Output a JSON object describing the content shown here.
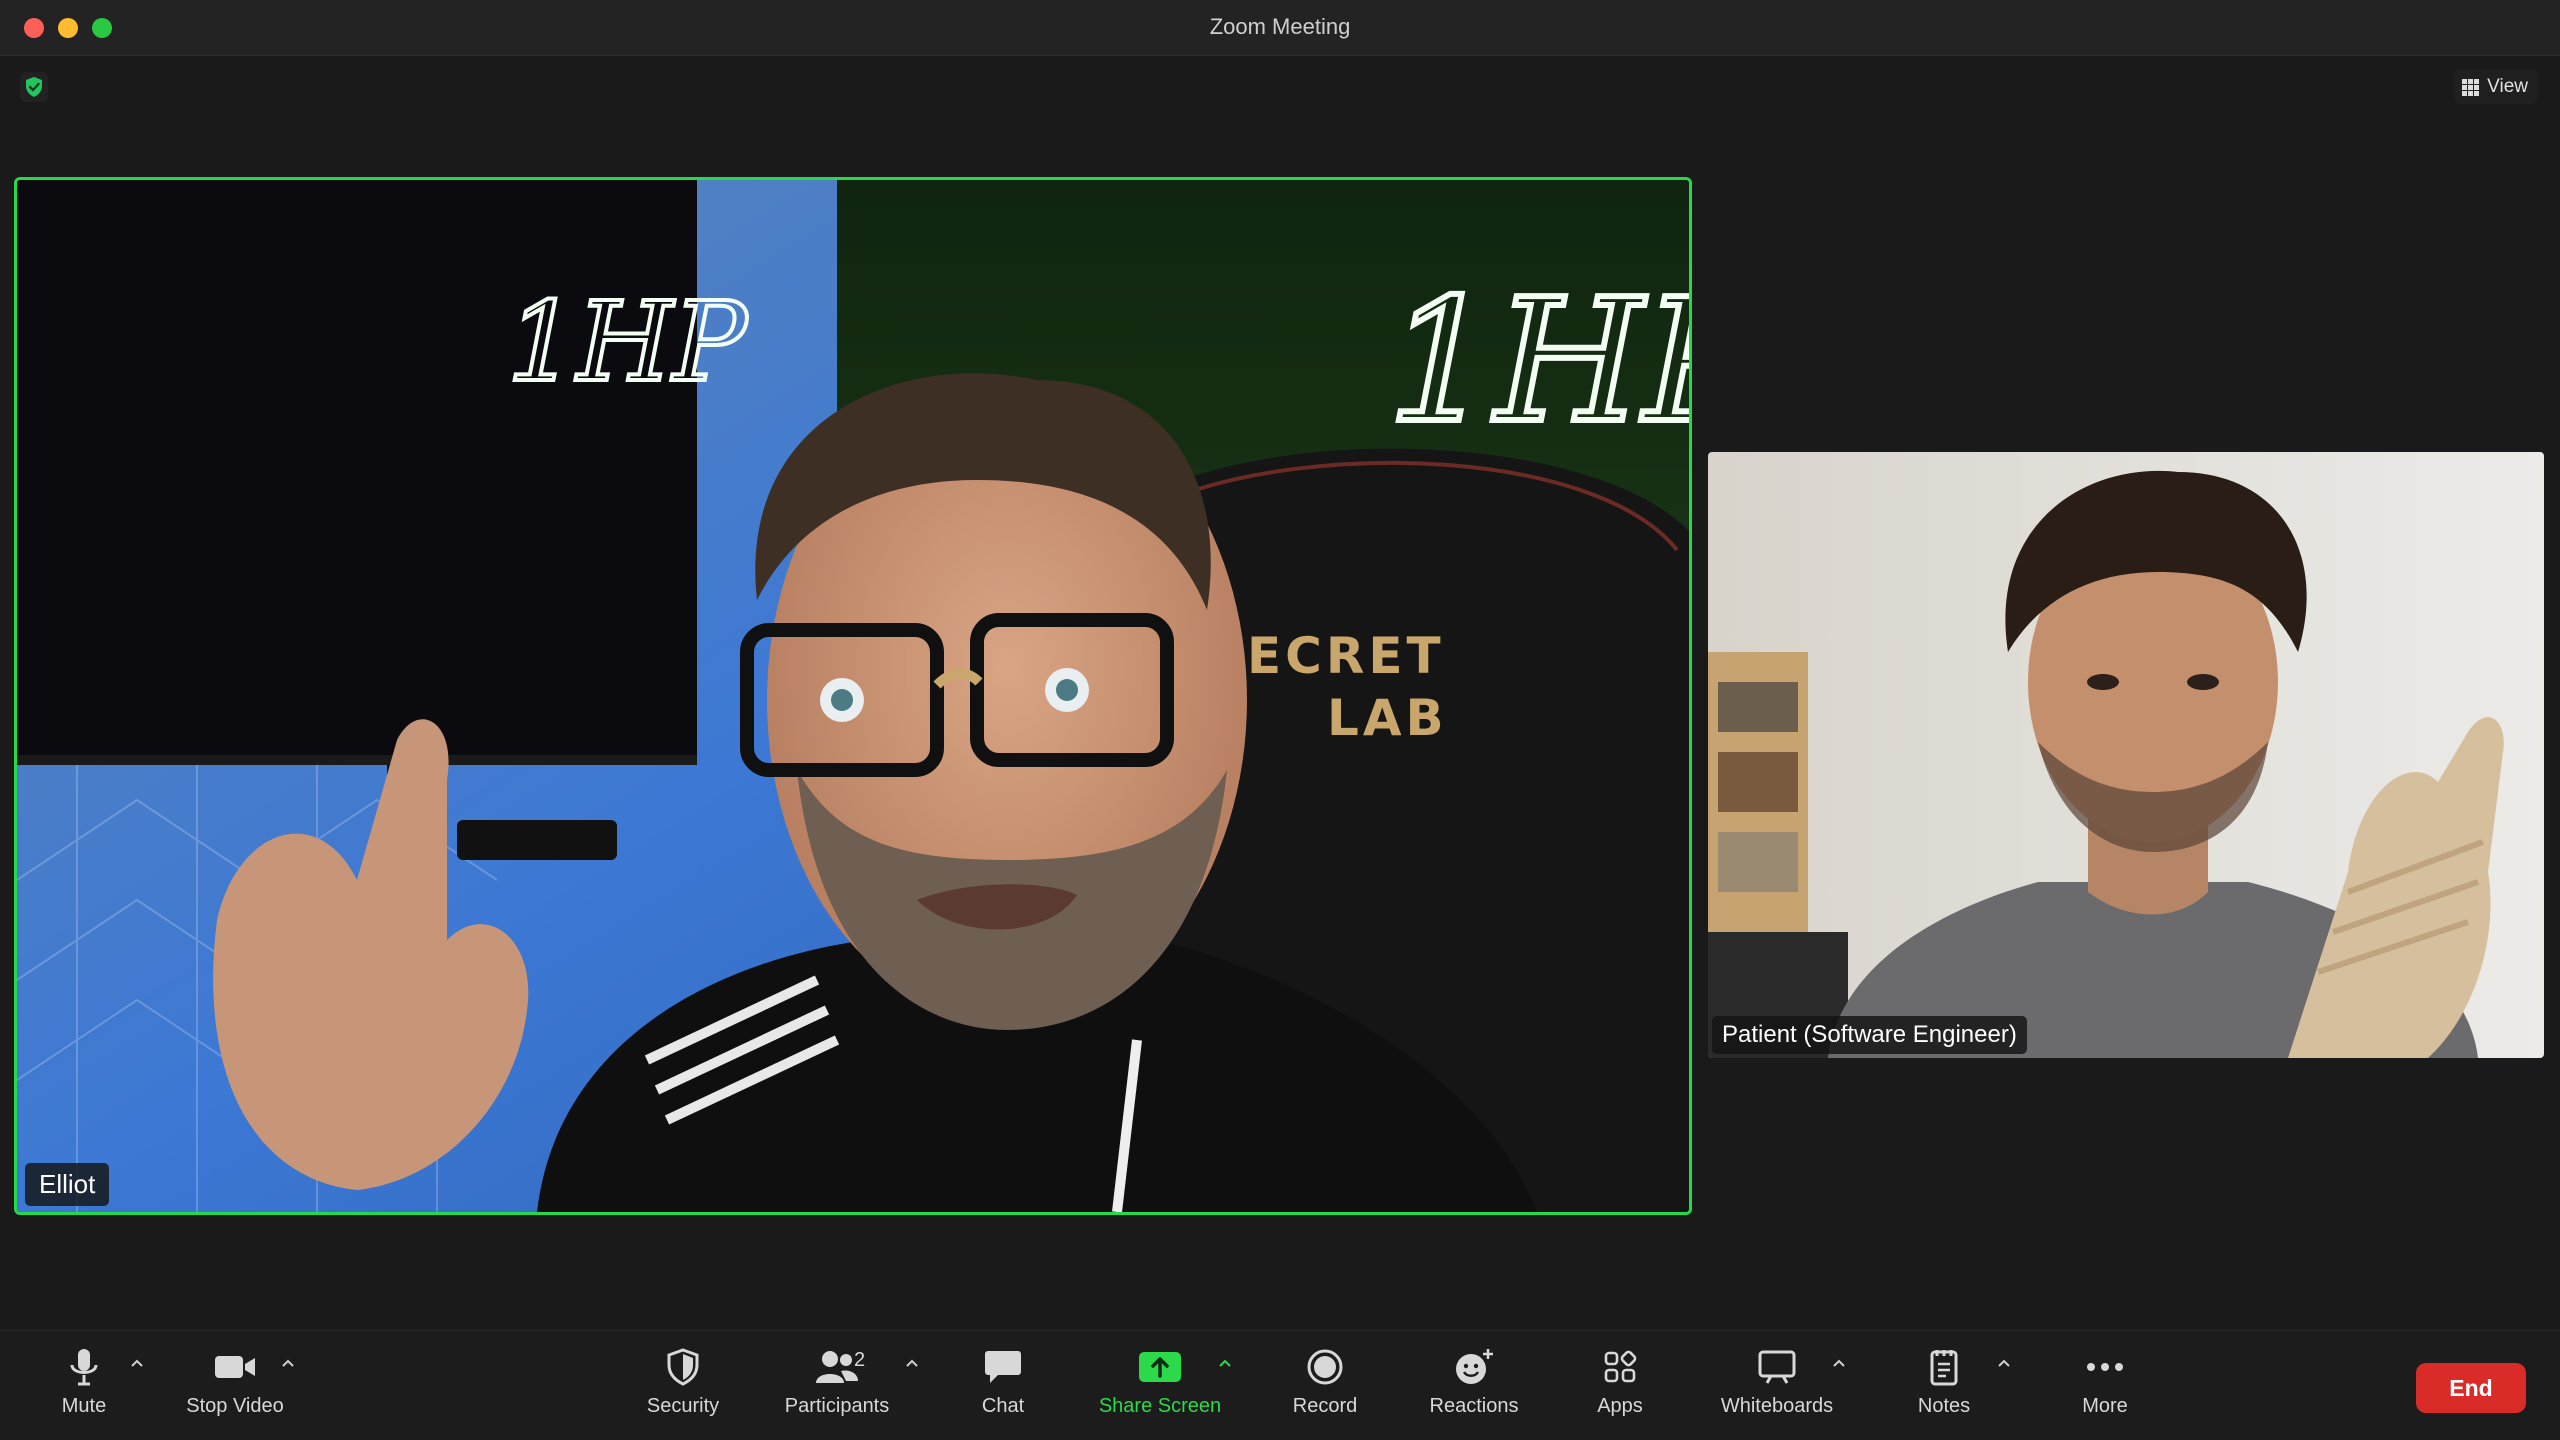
{
  "window": {
    "title": "Zoom Meeting"
  },
  "top": {
    "view_label": "View"
  },
  "participants": [
    {
      "name": "Elliot",
      "active_speaker": true
    },
    {
      "name": "Patient (Software Engineer)",
      "active_speaker": false
    }
  ],
  "toolbar": {
    "mute": "Mute",
    "stop_video": "Stop Video",
    "security": "Security",
    "participants": "Participants",
    "participants_count": "2",
    "chat": "Chat",
    "share_screen": "Share Screen",
    "record": "Record",
    "reactions": "Reactions",
    "apps": "Apps",
    "whiteboards": "Whiteboards",
    "notes": "Notes",
    "more": "More",
    "end": "End"
  },
  "colors": {
    "active_border": "#25d94a",
    "share_green": "#2bd94a",
    "end_red": "#d92b28"
  }
}
